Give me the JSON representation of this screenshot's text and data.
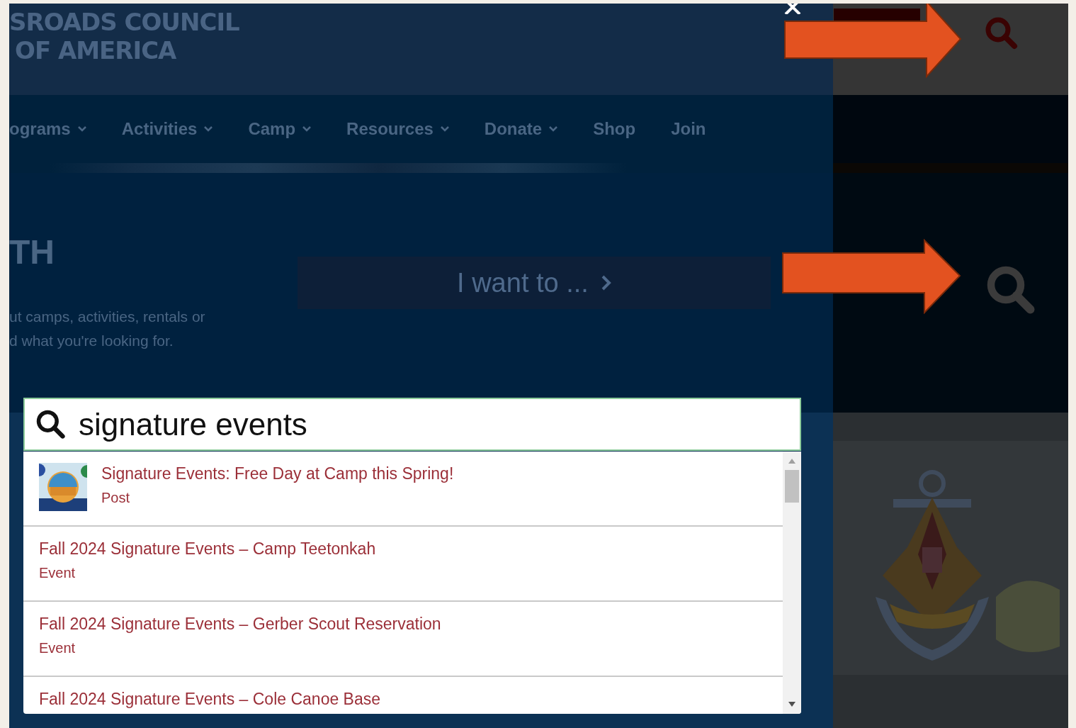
{
  "header": {
    "logo_lines": [
      "SROADS COUNCIL",
      "OF AMERICA"
    ]
  },
  "nav": [
    {
      "label": "ograms",
      "dropdown": true
    },
    {
      "label": "Activities",
      "dropdown": true
    },
    {
      "label": "Camp",
      "dropdown": true
    },
    {
      "label": "Resources",
      "dropdown": true
    },
    {
      "label": "Donate",
      "dropdown": true
    },
    {
      "label": "Shop",
      "dropdown": false
    },
    {
      "label": "Join",
      "dropdown": false
    }
  ],
  "hero": {
    "heading": "TH",
    "text_lines": [
      "ut camps, activities, rentals or",
      "d what you're looking for."
    ],
    "cta": "I want to ..."
  },
  "search": {
    "value": "signature events"
  },
  "results": [
    {
      "title": "Signature Events: Free Day at Camp this Spring!",
      "type": "Post",
      "thumbnail": true
    },
    {
      "title": "Fall 2024 Signature Events – Camp Teetonkah",
      "type": "Event",
      "thumbnail": false
    },
    {
      "title": "Fall 2024 Signature Events – Gerber Scout Reservation",
      "type": "Event",
      "thumbnail": false
    },
    {
      "title": "Fall 2024 Signature Events – Cole Canoe Base",
      "thumbnail": false
    }
  ]
}
